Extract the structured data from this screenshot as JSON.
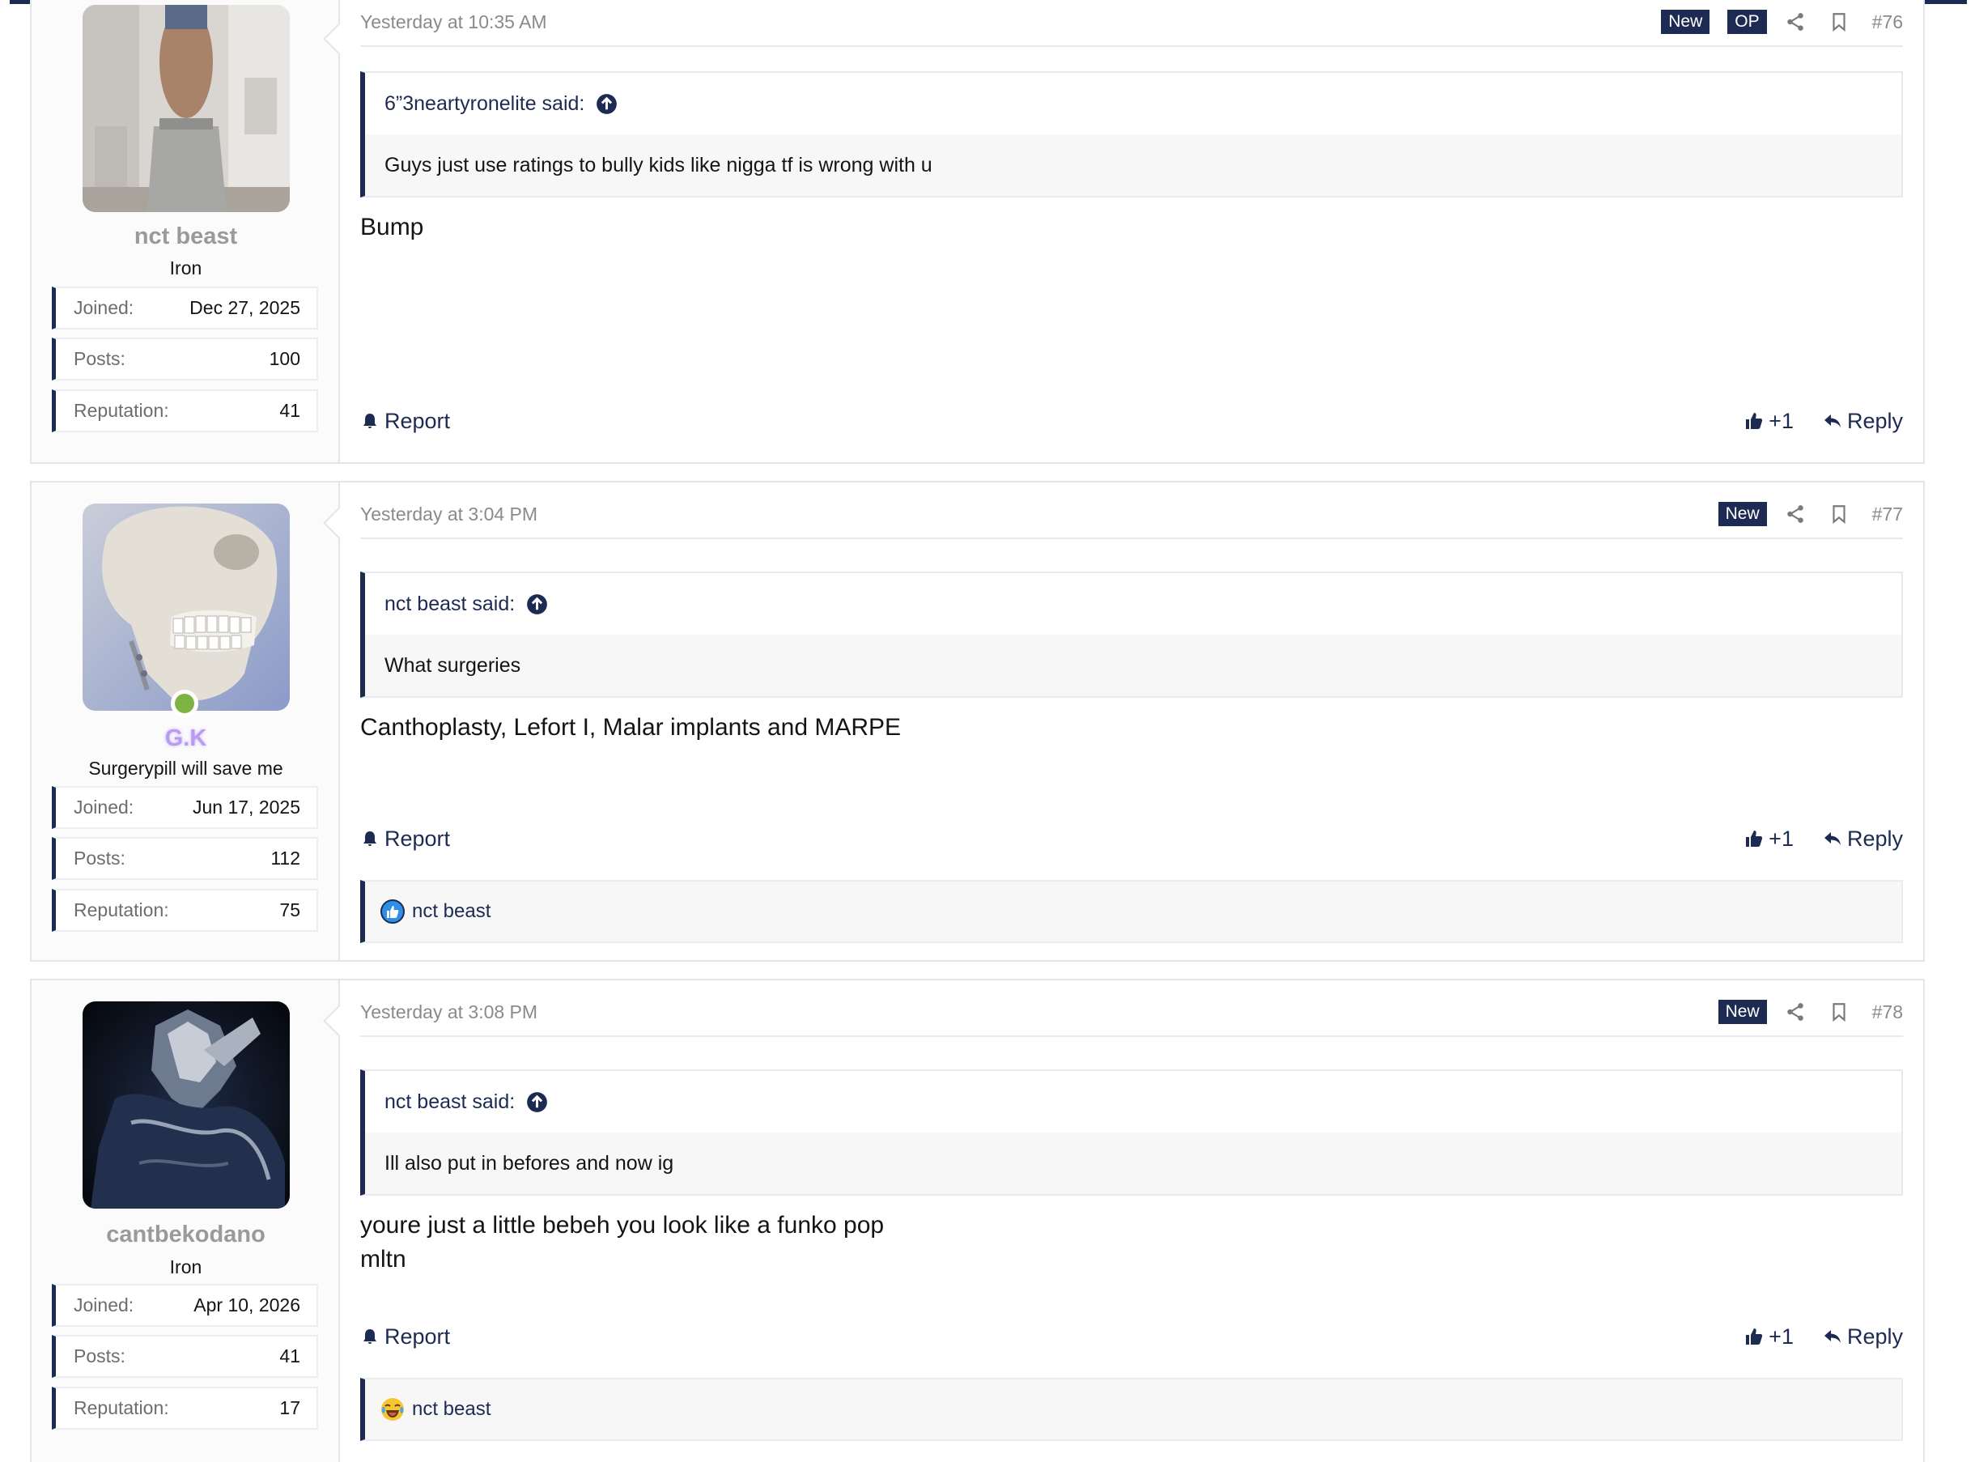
{
  "posts": [
    {
      "username": "nct beast",
      "user_title": "Iron",
      "stats": [
        {
          "key": "Joined:",
          "value": "Dec 27, 2025"
        },
        {
          "key": "Posts:",
          "value": "100"
        },
        {
          "key": "Reputation:",
          "value": "41"
        }
      ],
      "date": "Yesterday at 10:35 AM",
      "badges": [
        "New",
        "OP"
      ],
      "number": "#76",
      "quote_author": "6”3neartyronelite said:",
      "quote_text": "Guys just use ratings to bully kids like nigga tf is wrong with u",
      "body_lines": [
        "Bump"
      ],
      "report_label": "Report",
      "like_label": "+1",
      "reply_label": "Reply"
    },
    {
      "username": "G.K",
      "user_title": "Surgerypill will save me",
      "stats": [
        {
          "key": "Joined:",
          "value": "Jun 17, 2025"
        },
        {
          "key": "Posts:",
          "value": "112"
        },
        {
          "key": "Reputation:",
          "value": "75"
        }
      ],
      "date": "Yesterday at 3:04 PM",
      "badges": [
        "New"
      ],
      "number": "#77",
      "quote_author": "nct beast said:",
      "quote_text": "What surgeries",
      "body_lines": [
        "Canthoplasty, Lefort I, Malar implants and MARPE"
      ],
      "report_label": "Report",
      "like_label": "+1",
      "reply_label": "Reply",
      "reaction_user": "nct beast",
      "reaction_icon": "like-reaction-icon"
    },
    {
      "username": "cantbekodano",
      "user_title": "Iron",
      "stats": [
        {
          "key": "Joined:",
          "value": "Apr 10, 2026"
        },
        {
          "key": "Posts:",
          "value": "41"
        },
        {
          "key": "Reputation:",
          "value": "17"
        }
      ],
      "date": "Yesterday at 3:08 PM",
      "badges": [
        "New"
      ],
      "number": "#78",
      "quote_author": "nct beast said:",
      "quote_text": "Ill also put in befores and now ig",
      "body_lines": [
        "youre just a little bebeh you look like a funko pop",
        "mltn"
      ],
      "report_label": "Report",
      "like_label": "+1",
      "reply_label": "Reply",
      "reaction_user": "nct beast",
      "reaction_icon": "laugh-cry-reaction-icon"
    }
  ],
  "colors": {
    "accent": "#1d2b53",
    "online": "#7cb342",
    "username_gray": "#9a9a9a",
    "username_purple": "#b99bf0"
  }
}
